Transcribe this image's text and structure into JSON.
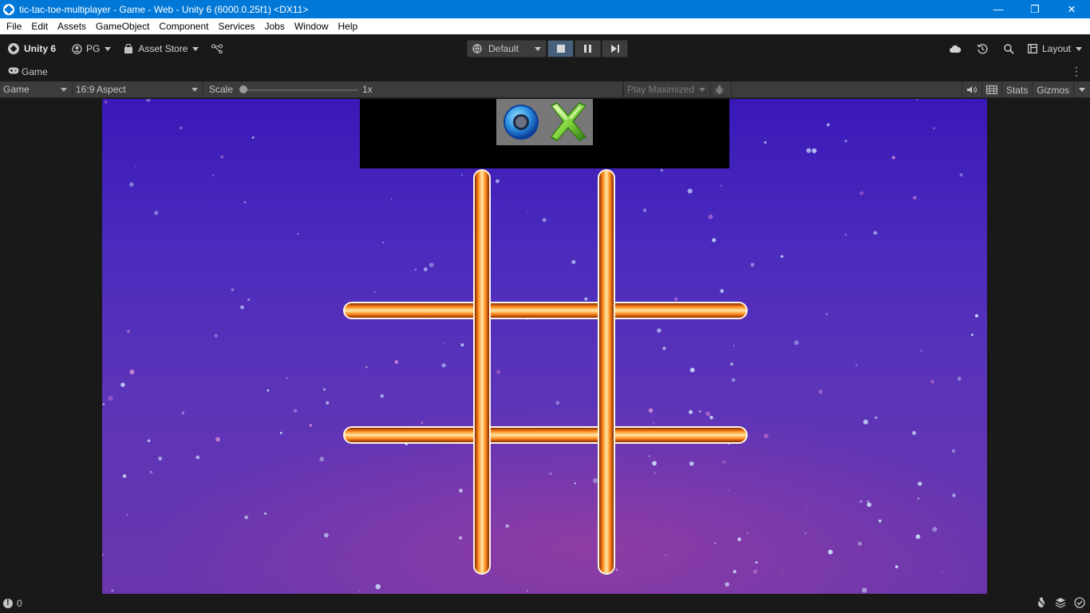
{
  "window": {
    "title": "tic-tac-toe-multiplayer - Game - Web - Unity 6 (6000.0.25f1) <DX11>",
    "minimize_glyph": "—",
    "maximize_glyph": "❐",
    "close_glyph": "✕"
  },
  "menu": [
    "File",
    "Edit",
    "Assets",
    "GameObject",
    "Component",
    "Services",
    "Jobs",
    "Window",
    "Help"
  ],
  "toolbar": {
    "unity_label": "Unity 6",
    "account_label": "PG",
    "asset_store_label": "Asset Store",
    "layout_dropdown": "Default",
    "layout_label": "Layout",
    "icons": [
      "unity-logo-icon",
      "account-icon",
      "asset-store-icon",
      "source-control-icon",
      "cloud-icon",
      "history-icon",
      "search-icon",
      "layout-icon"
    ]
  },
  "tab": {
    "label": "Game",
    "icon": "gamepad-icon"
  },
  "game_toolbar": {
    "display": "Game",
    "aspect": "16:9 Aspect",
    "scale_label": "Scale",
    "scale_value": "1x",
    "play_mode": "Play Maximized",
    "stats_label": "Stats",
    "gizmos_label": "Gizmos"
  },
  "status": {
    "count": "0"
  },
  "colors": {
    "title_bar": "#0078d7",
    "editor_bg": "#191919",
    "board_line": "#ff9a1e",
    "o_color": "#2a8fe0",
    "x_color": "#7ed13a"
  }
}
